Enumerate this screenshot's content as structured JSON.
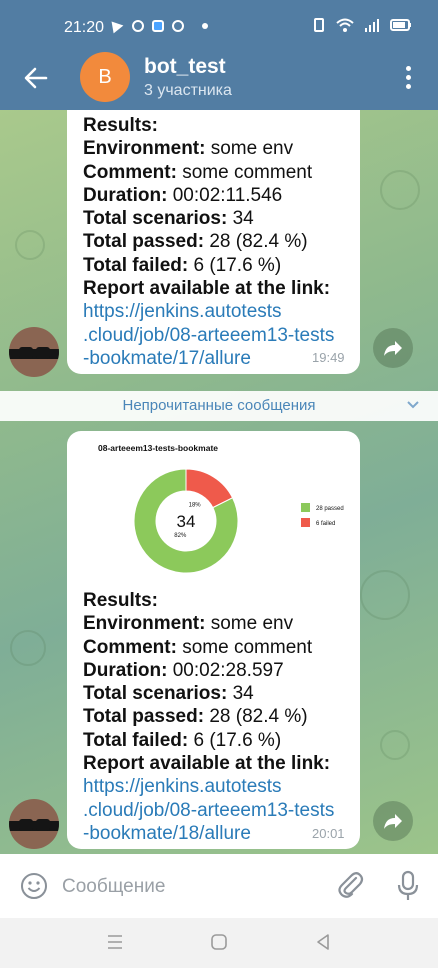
{
  "status_bar": {
    "time": "21:20"
  },
  "header": {
    "avatar_letter": "B",
    "title": "bot_test",
    "subtitle": "3 участника"
  },
  "messages": [
    {
      "lines": [
        {
          "bold": "Results:",
          "rest": ""
        },
        {
          "bold": "Environment:",
          "rest": " some env"
        },
        {
          "bold": "Comment:",
          "rest": " some comment"
        },
        {
          "bold": "Duration:",
          "rest": " 00:02:11.546"
        },
        {
          "bold": "Total scenarios:",
          "rest": " 34"
        },
        {
          "bold": "Total passed:",
          "rest": " 28 (82.4 %)"
        },
        {
          "bold": "Total failed:",
          "rest": " 6 (17.6 %)"
        },
        {
          "bold": "Report available at the link:",
          "rest": ""
        }
      ],
      "link_lines": [
        "https://jenkins.autotests",
        ".cloud/job/08-arteeem13-tests",
        "-bookmate/17/allure"
      ],
      "time": "19:49"
    },
    {
      "chart_title": "08-arteeem13-tests-bookmate",
      "lines": [
        {
          "bold": "Results:",
          "rest": ""
        },
        {
          "bold": "Environment:",
          "rest": " some env"
        },
        {
          "bold": "Comment:",
          "rest": " some comment"
        },
        {
          "bold": "Duration:",
          "rest": " 00:02:28.597"
        },
        {
          "bold": "Total scenarios:",
          "rest": " 34"
        },
        {
          "bold": "Total passed:",
          "rest": " 28 (82.4 %)"
        },
        {
          "bold": "Total failed:",
          "rest": " 6 (17.6 %)"
        },
        {
          "bold": "Report available at the link:",
          "rest": ""
        }
      ],
      "link_lines": [
        "https://jenkins.autotests",
        ".cloud/job/08-arteeem13-tests",
        "-bookmate/18/allure"
      ],
      "time": "20:01"
    }
  ],
  "unread_divider": "Непрочитанные сообщения",
  "chart_data": {
    "type": "pie",
    "title": "08-arteeem13-tests-bookmate",
    "center_label": "34",
    "slices": [
      {
        "name": "28 passed",
        "value": 28,
        "label": "82%",
        "color": "#8cc95b"
      },
      {
        "name": "6 failed",
        "value": 6,
        "label": "18%",
        "color": "#ef5a4b"
      }
    ],
    "legend_position": "right"
  },
  "input": {
    "placeholder": "Сообщение"
  },
  "colors": {
    "header": "#527da3",
    "link": "#2a7bb8",
    "avatar": "#f28a3c"
  },
  "icons": [
    "back-arrow-icon",
    "more-icon",
    "share-icon",
    "emoji-icon",
    "attach-icon",
    "mic-icon"
  ]
}
